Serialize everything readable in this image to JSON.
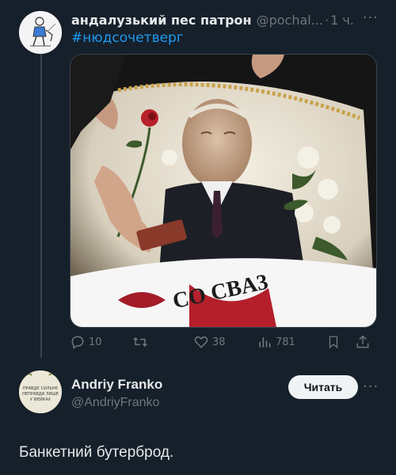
{
  "post": {
    "author_name": "андалузький пес патрон",
    "author_handle": "@pochal...",
    "separator": "·",
    "time": "1 ч.",
    "more_label": "···",
    "hashtag": "#нюдсочетверг",
    "media": {
      "banner_text": "CO CBA3",
      "document_color": "#8a3a2a"
    },
    "actions": {
      "replies": "10",
      "retweets": "",
      "likes": "38",
      "views": "781"
    }
  },
  "reply": {
    "author_name": "Andriy Franko",
    "author_handle": "@AndriyFranko",
    "follow_label": "Читать",
    "more_label": "···",
    "avatar_text": [
      "ПРАВДЄ СИЛЬНЄ",
      "НЕПРАВДИ ЛИШЕ",
      "У ФЕЙКАХ"
    ],
    "body": "Банкетний бутерброд."
  },
  "colors": {
    "background": "#15202b",
    "accent": "#1d9bf0",
    "muted": "#71767b"
  }
}
